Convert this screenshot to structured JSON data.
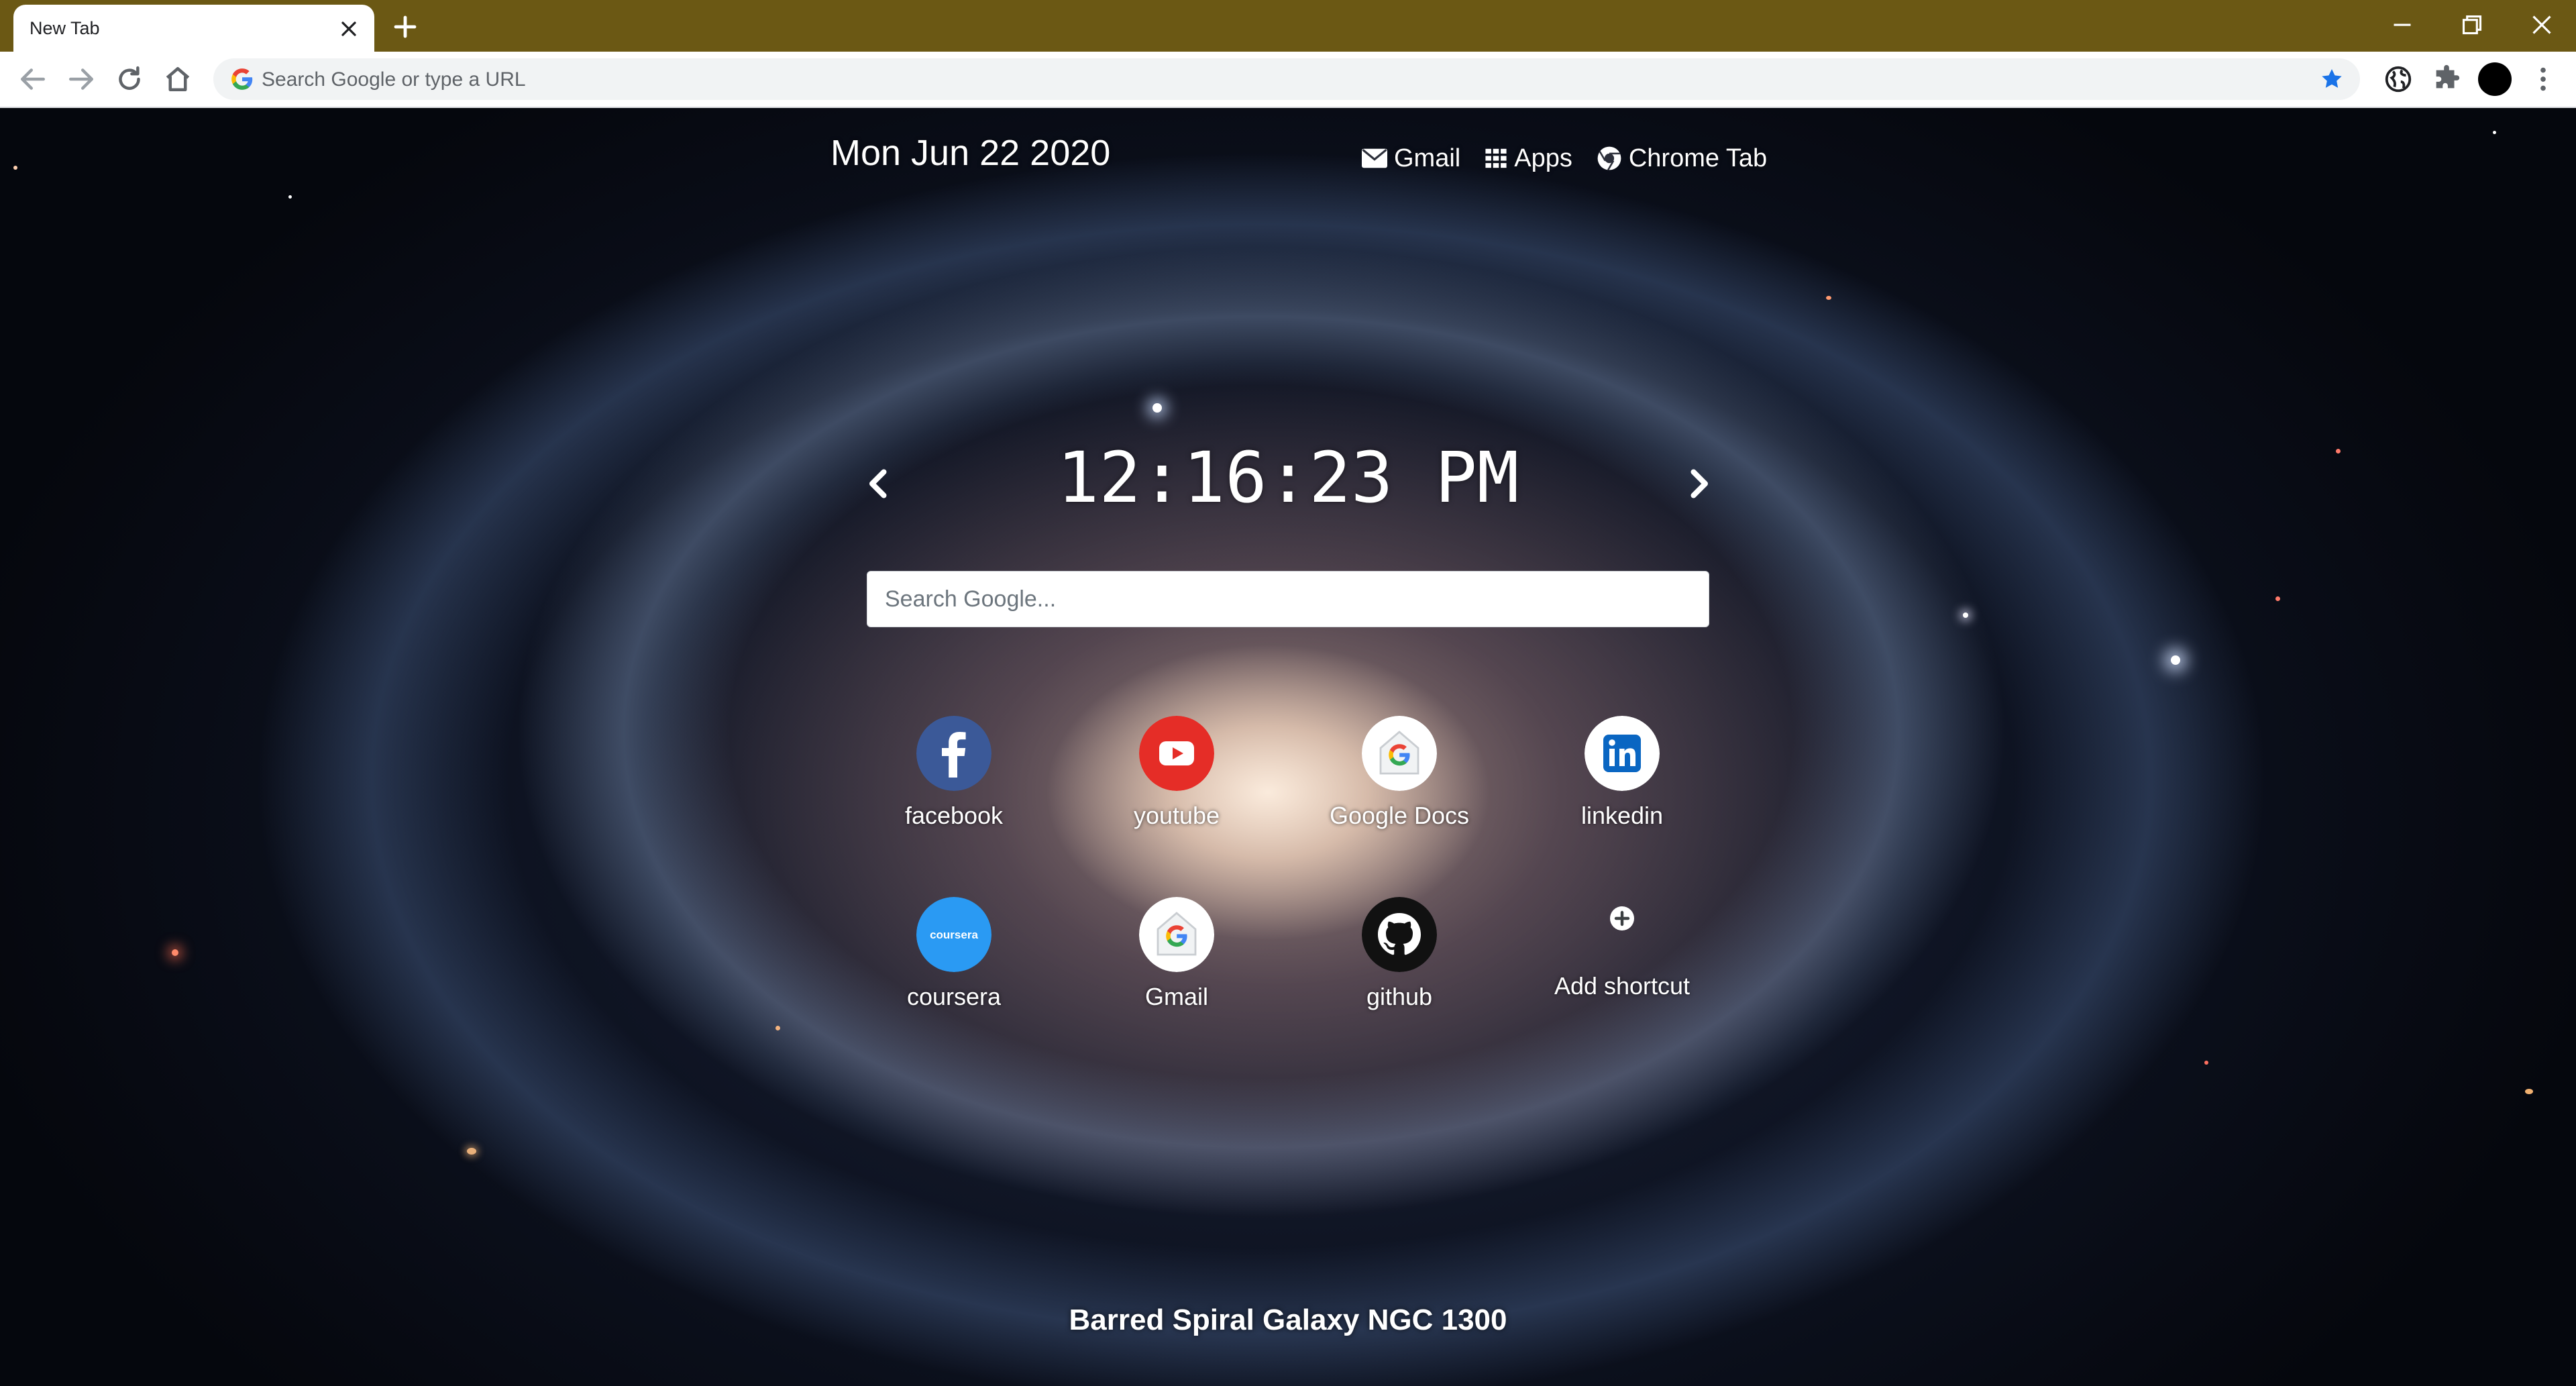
{
  "browser": {
    "tab_title": "New Tab",
    "address_placeholder": "Search Google or type a URL",
    "colors": {
      "titlebar": "#6b5814",
      "bookmark_star": "#1a73e8"
    }
  },
  "page": {
    "date": "Mon Jun 22 2020",
    "links": [
      {
        "label": "Gmail",
        "icon": "mail-icon"
      },
      {
        "label": "Apps",
        "icon": "apps-grid-icon"
      },
      {
        "label": "Chrome Tab",
        "icon": "chrome-icon"
      }
    ],
    "clock": "12:16:23 PM",
    "search_placeholder": "Search Google...",
    "shortcuts": [
      {
        "label": "facebook",
        "icon": "facebook-icon"
      },
      {
        "label": "youtube",
        "icon": "youtube-icon"
      },
      {
        "label": "Google Docs",
        "icon": "google-icon"
      },
      {
        "label": "linkedin",
        "icon": "linkedin-icon"
      },
      {
        "label": "coursera",
        "icon": "coursera-icon",
        "icon_text": "coursera"
      },
      {
        "label": "Gmail",
        "icon": "google-icon"
      },
      {
        "label": "github",
        "icon": "github-icon"
      },
      {
        "label": "Add shortcut",
        "icon": "plus-icon"
      }
    ],
    "background_caption": "Barred Spiral Galaxy NGC 1300"
  }
}
